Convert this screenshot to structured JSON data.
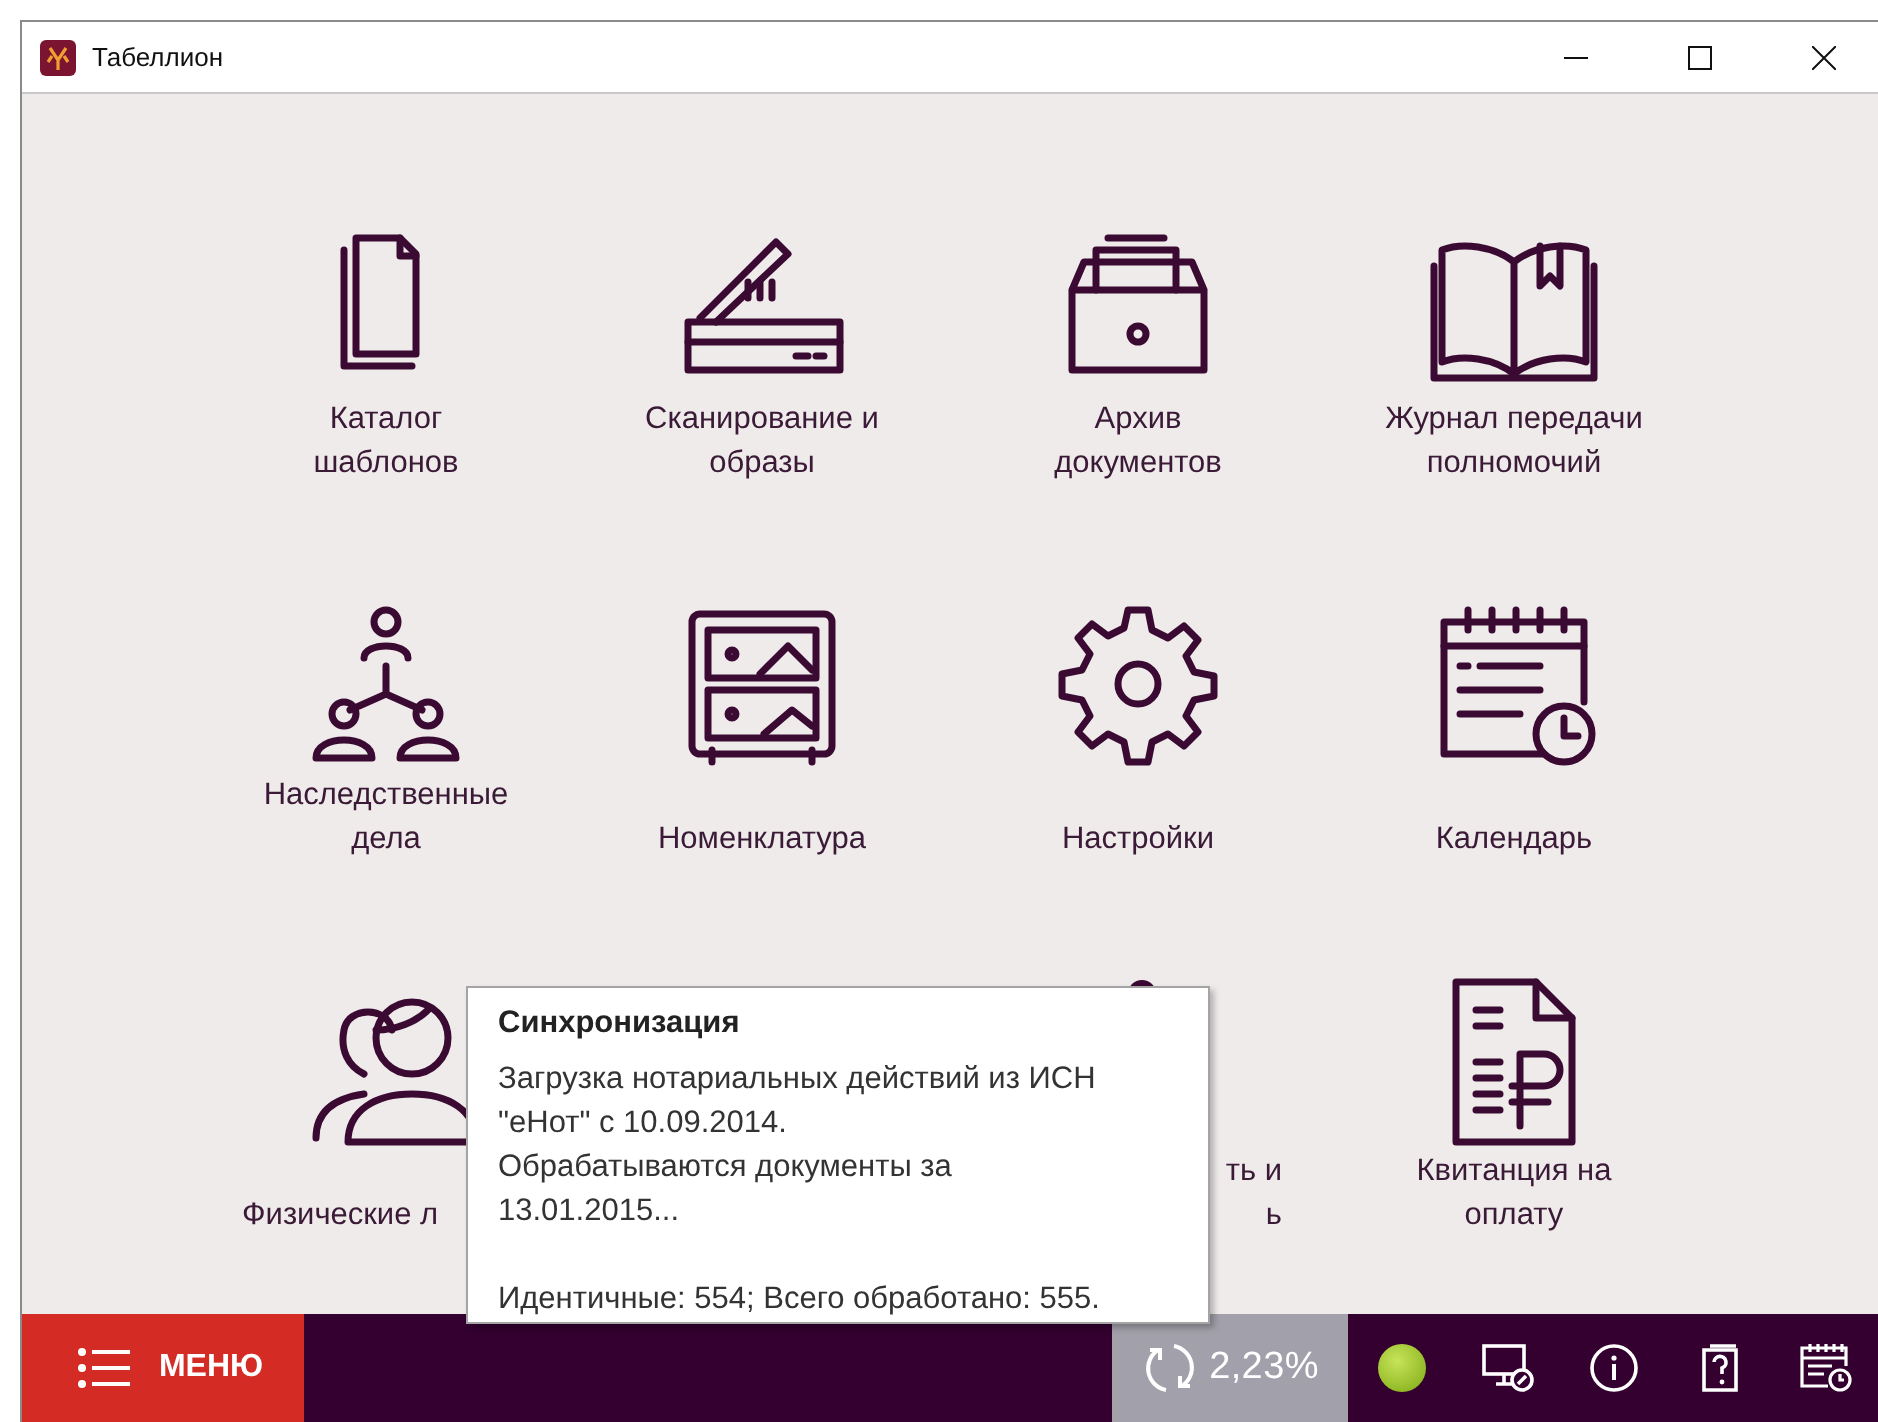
{
  "window": {
    "title": "Табеллион"
  },
  "tiles": [
    {
      "kind": "tile",
      "label": "Каталог\nшаблонов"
    },
    {
      "kind": "tile",
      "label": "Сканирование и\nобразы"
    },
    {
      "kind": "tile",
      "label": "Архив\nдокументов"
    },
    {
      "kind": "tile",
      "label": "Журнал передачи\nполномочий"
    },
    {
      "kind": "tile",
      "label": "Наследственные\nдела"
    },
    {
      "kind": "tile",
      "label": "Номенклатура"
    },
    {
      "kind": "tile",
      "label": "Настройки"
    },
    {
      "kind": "tile",
      "label": "Календарь"
    },
    {
      "kind": "covered_right",
      "label": "Физические л"
    },
    {
      "kind": "hidden"
    },
    {
      "kind": "covered_left",
      "label": "ть и\nь"
    },
    {
      "kind": "tile",
      "label": "Квитанция на\nоплату"
    }
  ],
  "tooltip": {
    "title": "Синхронизация",
    "text": "Загрузка нотариальных действий из ИСН\n\"еНот\" с 10.09.2014.\nОбрабатываются документы за\n13.01.2015...",
    "summary": "Идентичные: 554; Всего обработано: 555."
  },
  "bottom_bar": {
    "menu_label": "МЕНЮ",
    "sync_percent": "2,23%",
    "connected": true
  }
}
